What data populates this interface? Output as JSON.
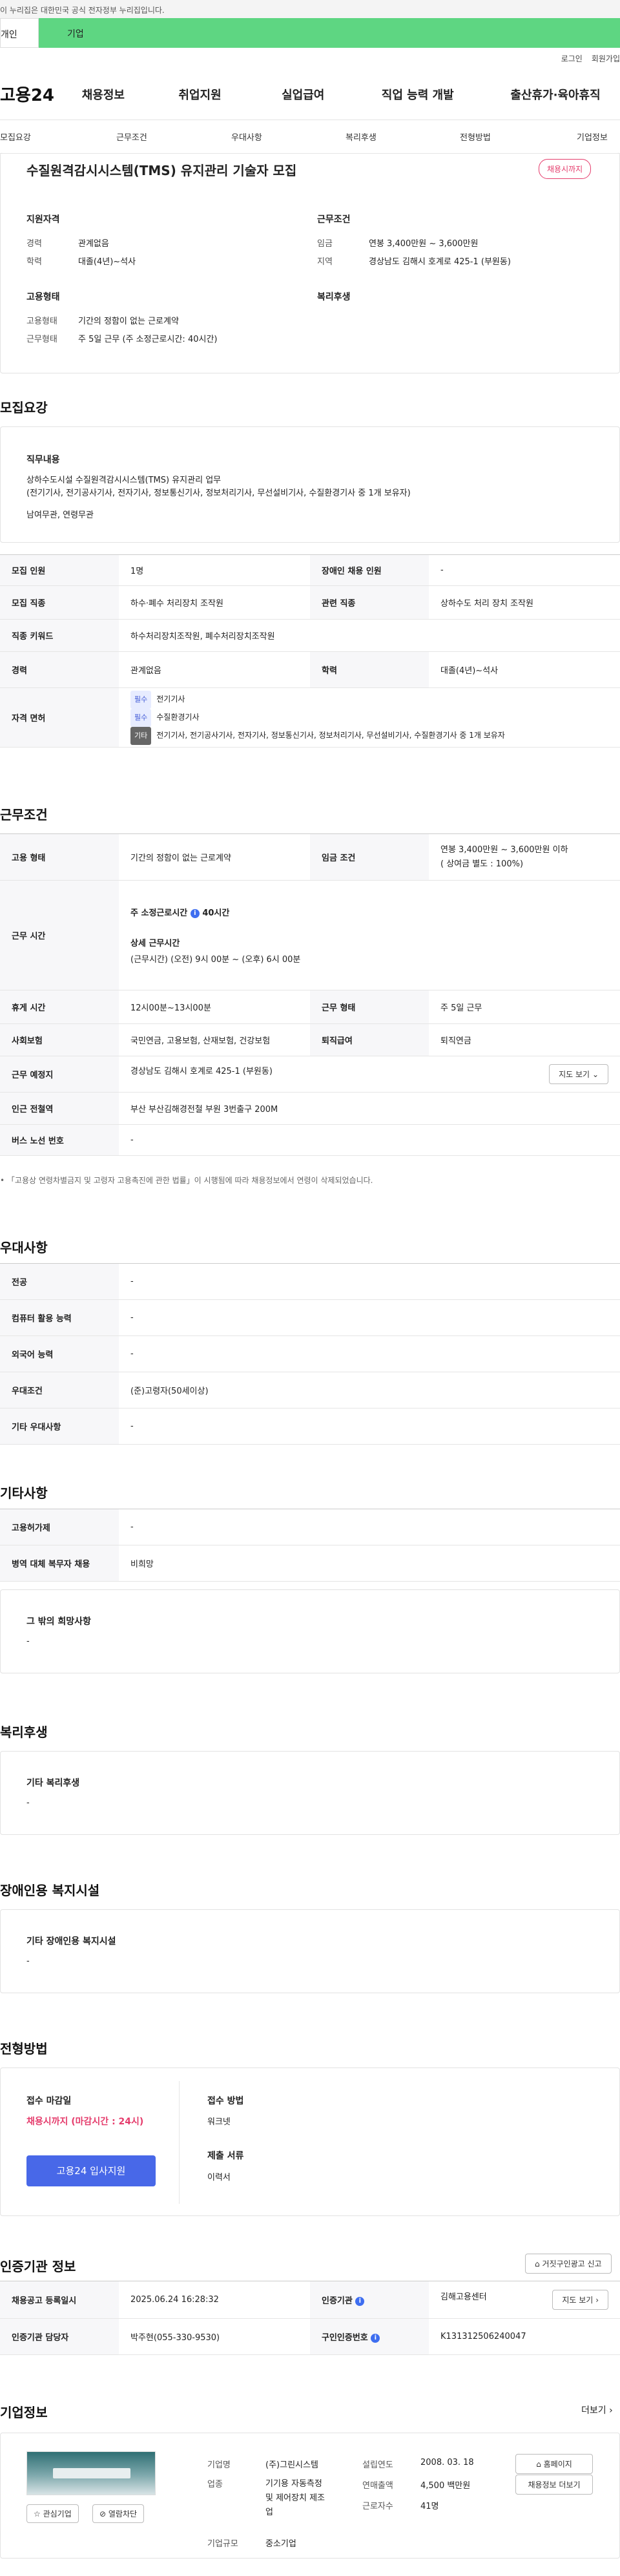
{
  "gov_banner": "이 누리집은 대한민국 공식 전자정부 누리집입니다.",
  "top_tabs": [
    "개인",
    "기업"
  ],
  "util": [
    "로그인",
    "회원가입"
  ],
  "logo": "고용24",
  "gnb": [
    "채용정보",
    "취업지원",
    "실업급여",
    "직업 능력 개발",
    "출산휴가·육아휴직"
  ],
  "subnav": [
    "모집요강",
    "근무조건",
    "우대사항",
    "복리후생",
    "전형방법",
    "기업정보"
  ],
  "header": {
    "title": "수질원격감시시스템(TMS) 유지관리 기술자 모집",
    "badge": "채용시까지",
    "qual_title": "지원자격",
    "career_label": "경력",
    "career_value": "관계없음",
    "edu_label": "학력",
    "edu_value": "대졸(4년)~석사",
    "cond_title": "근무조건",
    "wage_label": "임금",
    "wage_value": "연봉 3,400만원 ~ 3,600만원",
    "region_label": "지역",
    "region_value": "경상남도 김해시 호계로 425-1 (부원동)",
    "emp_title": "고용형태",
    "emptype_label": "고용형태",
    "emptype_value": "기간의 정함이 없는 근로계약",
    "worktype_label": "근무형태",
    "worktype_value": "주 5일 근무 (주 소정근로시간: 40시간)",
    "welfare_title": "복리후생"
  },
  "recruit": {
    "section_title": "모집요강",
    "job_title": "직무내용",
    "job_desc_1": "상하수도시설 수질원격감시시스템(TMS) 유지관리 업무",
    "job_desc_2": "(전기기사, 전기공사기사, 전자기사, 정보통신기사, 정보처리기사, 무선설비기사, 수질환경기사 중 1개 보유자)",
    "job_desc_3": "남여무관, 연령무관",
    "rows": {
      "people_label": "모집 인원",
      "people_value": "1명",
      "disabled_label": "장애인 채용 인원",
      "disabled_value": "-",
      "occupation_label": "모집 직종",
      "occupation_value": "하수·폐수 처리장치 조작원",
      "related_label": "관련 직종",
      "related_value": "상하수도 처리 장치 조작원",
      "keyword_label": "직종 키워드",
      "keyword_value": "하수처리장치조작원, 폐수처리장치조작원",
      "career_label": "경력",
      "career_value": "관계없음",
      "edu_label": "학력",
      "edu_value": "대졸(4년)~석사",
      "license_label": "자격 면허",
      "license": [
        {
          "tag": "필수",
          "text": "전기기사"
        },
        {
          "tag": "필수",
          "text": "수질환경기사"
        },
        {
          "tag": "기타",
          "text": "전기기사, 전기공사기사, 전자기사, 정보통신기사, 정보처리기사, 무선설비기사, 수질환경기사 중 1개 보유자"
        }
      ]
    }
  },
  "work": {
    "section_title": "근무조건",
    "emptype_label": "고용 형태",
    "emptype_value": "기간의 정함이 없는 근로계약",
    "wage_label": "임금 조건",
    "wage_value_1": "연봉 3,400만원 ~ 3,600만원 이하",
    "wage_value_2": "( 상여금 별도 : 100%)",
    "hours_label": "근무 시간",
    "hours_weekly": "주 소정근로시간",
    "hours_weekly_value": "40시간",
    "hours_detail_title": "상세 근무시간",
    "hours_detail": "(근무시간) (오전) 9시 00분 ~ (오후) 6시 00분",
    "break_label": "휴게 시간",
    "break_value": "12시00분~13시00분",
    "worktype_label": "근무 형태",
    "worktype_value": "주 5일 근무",
    "insurance_label": "사회보험",
    "insurance_value": "국민연금, 고용보험, 산재보험, 건강보험",
    "retire_label": "퇴직급여",
    "retire_value": "퇴직연금",
    "place_label": "근무 예정지",
    "place_value": "경상남도 김해시 호계로 425-1 (부원동)",
    "map_btn": "지도 보기",
    "station_label": "인근 전철역",
    "station_value": "부산 부산김해경전철 부원 3번출구 200M",
    "bus_label": "버스 노선 번호",
    "bus_value": "-",
    "note": "「고용상 연령차별금지 및 고령자 고용촉진에 관한 법률」이 시행됨에 따라 채용정보에서 연령이 삭제되었습니다."
  },
  "pref": {
    "section_title": "우대사항",
    "rows": [
      {
        "label": "전공",
        "value": "-"
      },
      {
        "label": "컴퓨터 활용 능력",
        "value": "-"
      },
      {
        "label": "외국어 능력",
        "value": "-"
      },
      {
        "label": "우대조건",
        "value": "(준)고령자(50세이상)"
      },
      {
        "label": "기타 우대사항",
        "value": "-"
      }
    ]
  },
  "etc": {
    "section_title": "기타사항",
    "rows": [
      {
        "label": "고용허가제",
        "value": "-"
      },
      {
        "label": "병역 대체 복무자 채용",
        "value": "비희망"
      }
    ],
    "other_title": "그 밖의 희망사항",
    "other_value": "-"
  },
  "welfare": {
    "section_title": "복리후생",
    "box_title": "기타 복리후생",
    "box_value": "-"
  },
  "disability": {
    "section_title": "장애인용 복지시설",
    "box_title": "기타 장애인용 복지시설",
    "box_value": "-"
  },
  "selection": {
    "section_title": "전형방법",
    "deadline_title": "접수 마감일",
    "deadline_value": "채용시까지 (마감시간 : 24시)",
    "apply_btn": "고용24 입사지원",
    "method_title": "접수 방법",
    "method_value": "워크넷",
    "docs_title": "제출 서류",
    "docs_value": "이력서"
  },
  "cert": {
    "section_title": "인증기관 정보",
    "report_btn": "거짓구인광고 신고",
    "reg_label": "채용공고 등록일시",
    "reg_value": "2025.06.24 16:28:32",
    "org_label": "인증기관",
    "org_value": "김해고용센터",
    "map_btn": "지도 보기",
    "manager_label": "인증기관 담당자",
    "manager_value": "박주현(055-330-9530)",
    "num_label": "구인인증번호",
    "num_value": "K131312506240047"
  },
  "company": {
    "section_title": "기업정보",
    "more": "더보기",
    "name_label": "기업명",
    "name_value": "(주)그린시스템",
    "industry_label": "업종",
    "industry_value_1": "기기용 자동측정",
    "industry_value_2": "및 제어장치 제조",
    "industry_value_3": "업",
    "size_label": "기업규모",
    "size_value": "중소기업",
    "founded_label": "설립연도",
    "founded_value": "2008. 03. 18",
    "sales_label": "연매출액",
    "sales_value": "4,500 백만원",
    "staff_label": "근로자수",
    "staff_value": "41명",
    "homepage_btn": "홈페이지",
    "more_jobs_btn": "채용정보 더보기",
    "interest_btn": "관심기업",
    "block_btn": "열람차단"
  },
  "colors": {
    "accent_green": "#5ed682",
    "brand_blue": "#4868e8",
    "badge_red": "#e53d6d"
  }
}
